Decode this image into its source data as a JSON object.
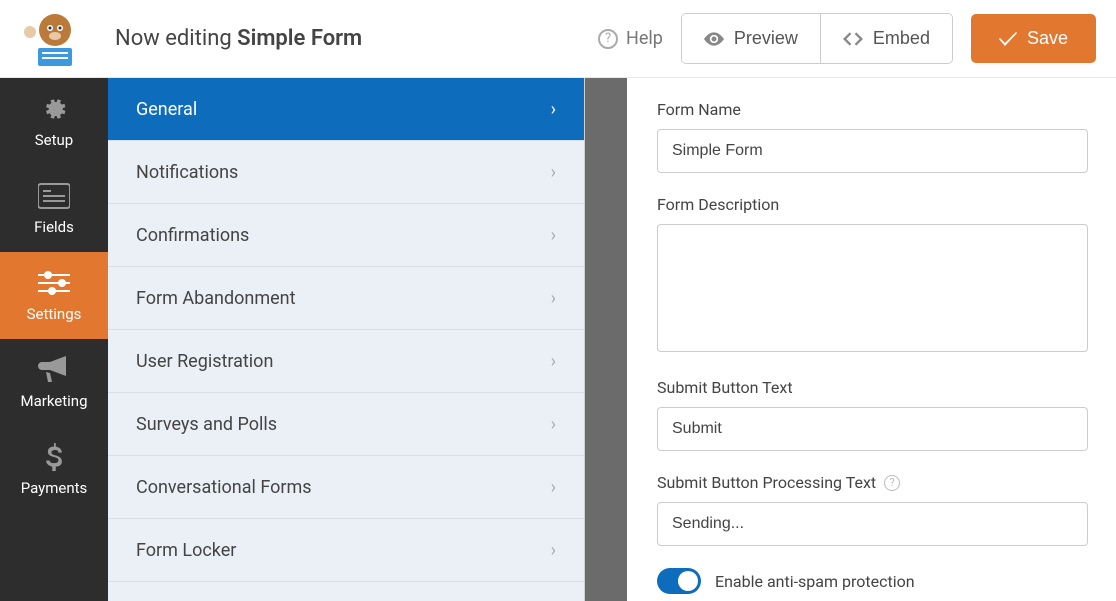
{
  "header": {
    "editing_prefix": "Now editing ",
    "editing_title": "Simple Form",
    "help_label": "Help",
    "preview_label": "Preview",
    "embed_label": "Embed",
    "save_label": "Save"
  },
  "sidebar": {
    "items": [
      {
        "label": "Setup"
      },
      {
        "label": "Fields"
      },
      {
        "label": "Settings"
      },
      {
        "label": "Marketing"
      },
      {
        "label": "Payments"
      }
    ]
  },
  "subpanel": {
    "items": [
      {
        "label": "General"
      },
      {
        "label": "Notifications"
      },
      {
        "label": "Confirmations"
      },
      {
        "label": "Form Abandonment"
      },
      {
        "label": "User Registration"
      },
      {
        "label": "Surveys and Polls"
      },
      {
        "label": "Conversational Forms"
      },
      {
        "label": "Form Locker"
      }
    ]
  },
  "form": {
    "form_name_label": "Form Name",
    "form_name_value": "Simple Form",
    "form_desc_label": "Form Description",
    "form_desc_value": "",
    "submit_btn_label": "Submit Button Text",
    "submit_btn_value": "Submit",
    "submit_proc_label": "Submit Button Processing Text",
    "submit_proc_value": "Sending...",
    "antispam_label": "Enable anti-spam protection"
  },
  "colors": {
    "accent": "#E27730",
    "primary": "#0E6CBD"
  }
}
